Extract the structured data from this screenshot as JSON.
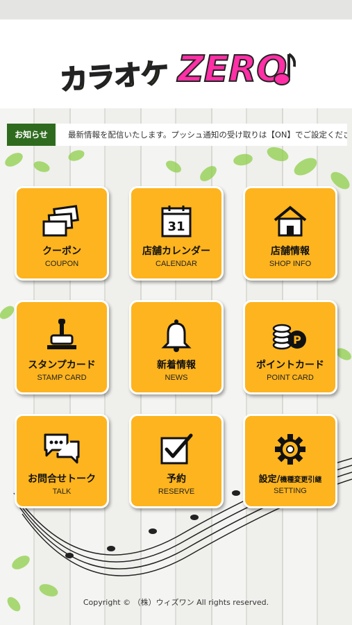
{
  "header": {
    "logo_kana": "カラオケ",
    "logo_zero": "ZERO"
  },
  "notice": {
    "badge": "お知らせ",
    "text": "最新情報を配信いたします。プッシュ通知の受け取りは【ON】でご設定ください。"
  },
  "menu": [
    {
      "title": "クーポン",
      "sub": "COUPON",
      "icon": "coupon-icon"
    },
    {
      "title": "店舗カレンダー",
      "sub": "CALENDAR",
      "icon": "calendar-icon",
      "icon_text": "31"
    },
    {
      "title": "店舗情報",
      "sub": "SHOP INFO",
      "icon": "shop-icon"
    },
    {
      "title": "スタンプカード",
      "sub": "STAMP CARD",
      "icon": "stamp-icon"
    },
    {
      "title": "新着情報",
      "sub": "NEWS",
      "icon": "bell-icon"
    },
    {
      "title": "ポイントカード",
      "sub": "POINT CARD",
      "icon": "coins-icon",
      "icon_text": "P"
    },
    {
      "title": "お問合せトーク",
      "sub": "TALK",
      "icon": "chat-icon"
    },
    {
      "title": "予約",
      "sub": "RESERVE",
      "icon": "checkbox-icon"
    },
    {
      "title_main": "設定/",
      "title_small": "機種変更引継",
      "sub": "SETTING",
      "icon": "gear-icon"
    }
  ],
  "footer": {
    "copyright": "Copyright © （株）ウィズワン All rights reserved."
  },
  "colors": {
    "tile": "#fdb41e",
    "notice_badge": "#2f6b1e",
    "logo_zero": "#ff2fa6",
    "logo_kana": "#ffe000"
  }
}
